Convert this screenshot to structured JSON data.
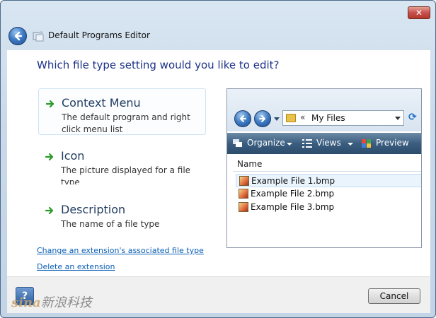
{
  "window": {
    "title": "Default Programs Editor",
    "close_glyph": "✕"
  },
  "main": {
    "heading": "Which file type setting would you like to edit?",
    "options": [
      {
        "title": "Context Menu",
        "description": "The default program and right click menu list"
      },
      {
        "title": "Icon",
        "description": "The picture displayed for a file type"
      },
      {
        "title": "Description",
        "description": "The name of a file type"
      }
    ],
    "links": [
      "Change an extension's associated file type",
      "Delete an extension"
    ]
  },
  "preview": {
    "address_separator": "«",
    "address": "My Files",
    "toolbar": {
      "organize": "Organize",
      "views": "Views",
      "preview": "Preview"
    },
    "column_header": "Name",
    "files": [
      "Example File 1.bmp",
      "Example File 2.bmp",
      "Example File 3.bmp"
    ]
  },
  "footer": {
    "help_glyph": "?",
    "watermark_brand": "sina",
    "watermark_text": "新浪科技",
    "cancel_label": "Cancel"
  },
  "colors": {
    "accent": "#1e3287",
    "link": "#0a5fb5",
    "arrow_green": "#2a9a2a"
  }
}
